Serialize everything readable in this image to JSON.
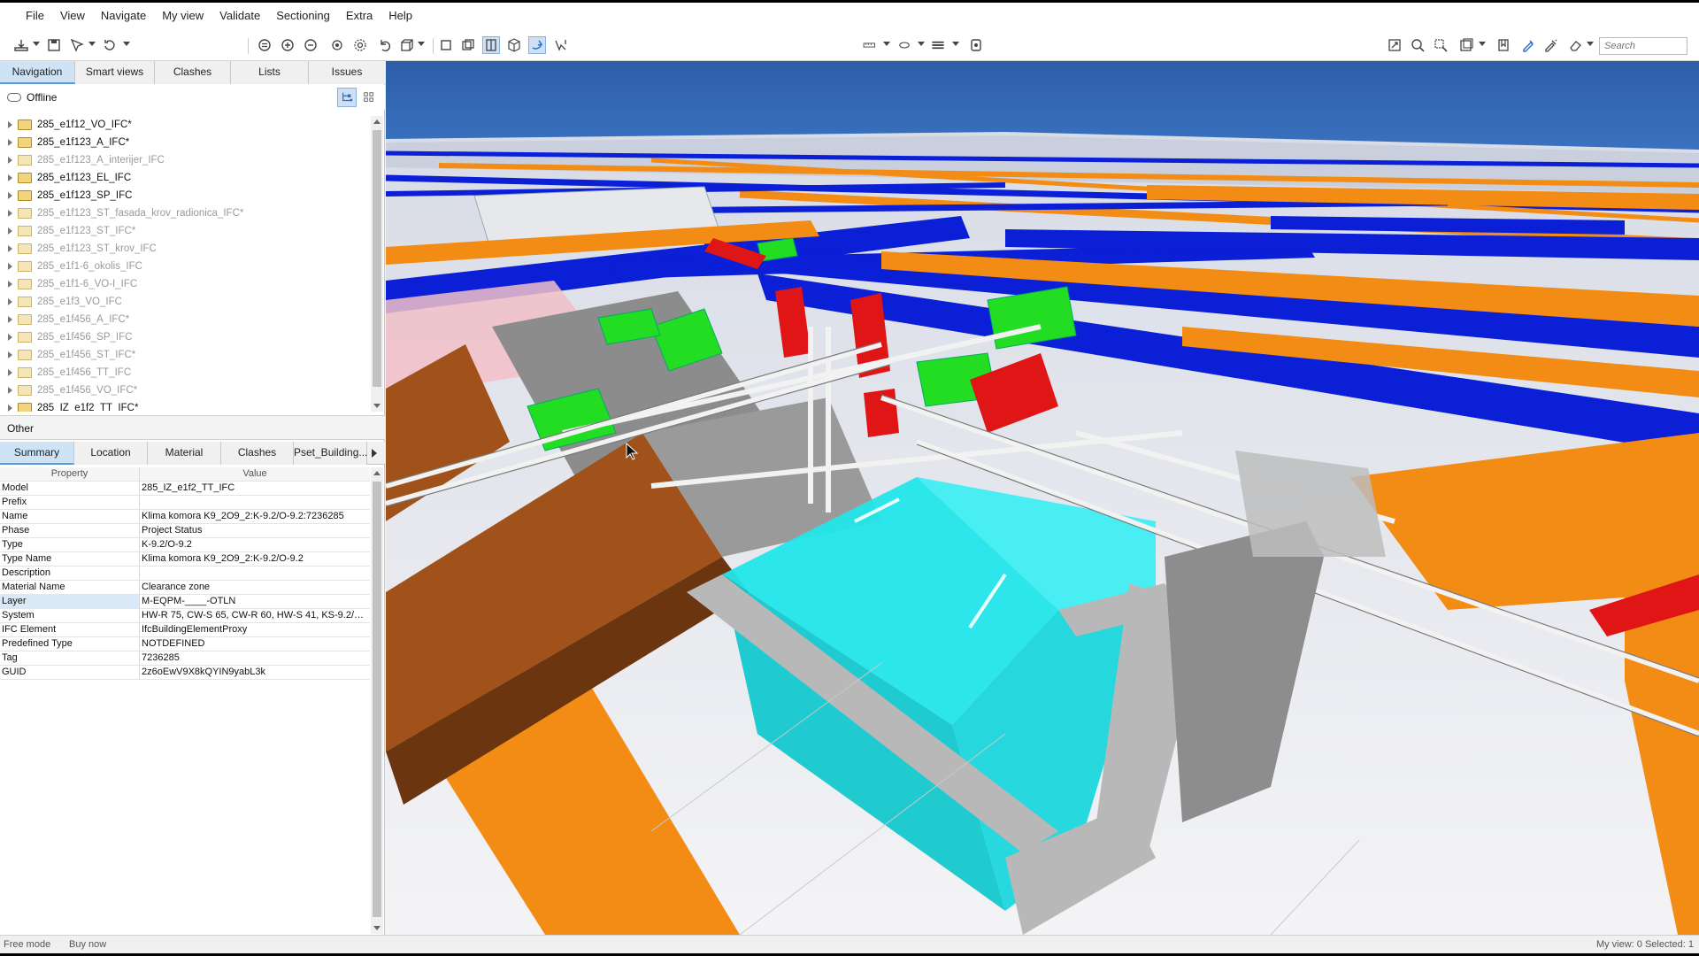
{
  "menu": [
    "File",
    "View",
    "Navigate",
    "My view",
    "Validate",
    "Sectioning",
    "Extra",
    "Help"
  ],
  "toolbar": {
    "search_placeholder": "Search",
    "icons": [
      "open-icon",
      "save-icon",
      "select-icon",
      "rotate-icon",
      "zoom-fit-icon",
      "zoom-in-icon",
      "zoom-out-icon",
      "walk-icon",
      "orbit-icon",
      "undo-icon",
      "view-cube-icon",
      "box-icon",
      "box2-icon",
      "section-icon",
      "cube-icon",
      "fly-icon",
      "pick-icon",
      "measure-icon",
      "ellipse-icon",
      "lines-icon",
      "presentation-icon",
      "fit-view-icon",
      "zoom-window-icon",
      "zoom-select-icon",
      "layers-icon",
      "bookmark-icon",
      "markup-icon",
      "markup2-icon",
      "eraser-icon"
    ]
  },
  "navigation_tabs": [
    "Navigation",
    "Smart views",
    "Clashes",
    "Lists",
    "Issues"
  ],
  "active_navigation_tab": "Navigation",
  "offline_label": "Offline",
  "tree": [
    {
      "label": "285_e1f12_VO_IFC*",
      "dim": false
    },
    {
      "label": "285_e1f123_A_IFC*",
      "dim": false
    },
    {
      "label": "285_e1f123_A_interijer_IFC",
      "dim": true
    },
    {
      "label": "285_e1f123_EL_IFC",
      "dim": false
    },
    {
      "label": "285_e1f123_SP_IFC",
      "dim": false
    },
    {
      "label": "285_e1f123_ST_fasada_krov_radionica_IFC*",
      "dim": true
    },
    {
      "label": "285_e1f123_ST_IFC*",
      "dim": true
    },
    {
      "label": "285_e1f123_ST_krov_IFC",
      "dim": true
    },
    {
      "label": "285_e1f1-6_okolis_IFC",
      "dim": true
    },
    {
      "label": "285_e1f1-6_VO-I_IFC",
      "dim": true
    },
    {
      "label": "285_e1f3_VO_IFC",
      "dim": true
    },
    {
      "label": "285_e1f456_A_IFC*",
      "dim": true
    },
    {
      "label": "285_e1f456_SP_IFC",
      "dim": true
    },
    {
      "label": "285_e1f456_ST_IFC*",
      "dim": true
    },
    {
      "label": "285_e1f456_TT_IFC",
      "dim": true
    },
    {
      "label": "285_e1f456_VO_IFC*",
      "dim": true
    },
    {
      "label": "285_IZ_e1f2_TT_IFC*",
      "dim": false
    }
  ],
  "other_label": "Other",
  "property_tabs": [
    "Summary",
    "Location",
    "Material",
    "Clashes",
    "Pset_Building..."
  ],
  "active_property_tab": "Summary",
  "property_columns": {
    "property": "Property",
    "value": "Value"
  },
  "properties": [
    {
      "k": "Model",
      "v": "285_IZ_e1f2_TT_IFC"
    },
    {
      "k": "Prefix",
      "v": ""
    },
    {
      "k": "Name",
      "v": "Klima komora K9_2O9_2:K-9.2/O-9.2:7236285"
    },
    {
      "k": "Phase",
      "v": "Project Status"
    },
    {
      "k": "Type",
      "v": "K-9.2/O-9.2"
    },
    {
      "k": "Type Name",
      "v": "Klima komora K9_2O9_2:K-9.2/O-9.2"
    },
    {
      "k": "Description",
      "v": ""
    },
    {
      "k": "Material Name",
      "v": "Clearance zone"
    },
    {
      "k": "Layer",
      "v": "M-EQPM-____-OTLN"
    },
    {
      "k": "System",
      "v": "HW-R 75, CW-S 65, CW-R 60, HW-S 41, KS-9.2/O9..."
    },
    {
      "k": "IFC Element",
      "v": "IfcBuildingElementProxy"
    },
    {
      "k": "Predefined Type",
      "v": "NOTDEFINED"
    },
    {
      "k": "Tag",
      "v": "7236285"
    },
    {
      "k": "GUID",
      "v": "2z6oEwV9X8kQYIN9yabL3k"
    }
  ],
  "selected_property": "Layer",
  "status": {
    "mode": "Free mode",
    "buy": "Buy now",
    "right": "My view: 0  Selected: 1"
  },
  "colors": {
    "sky": "#2f63b0",
    "duct_blue": "#0a1fd6",
    "duct_orange": "#f28c14",
    "selected_unit": "#22e6ea",
    "brown_duct": "#a0521a",
    "green_box": "#22dd22",
    "red_pipe": "#e01515",
    "accent": "#5b9bd5"
  }
}
